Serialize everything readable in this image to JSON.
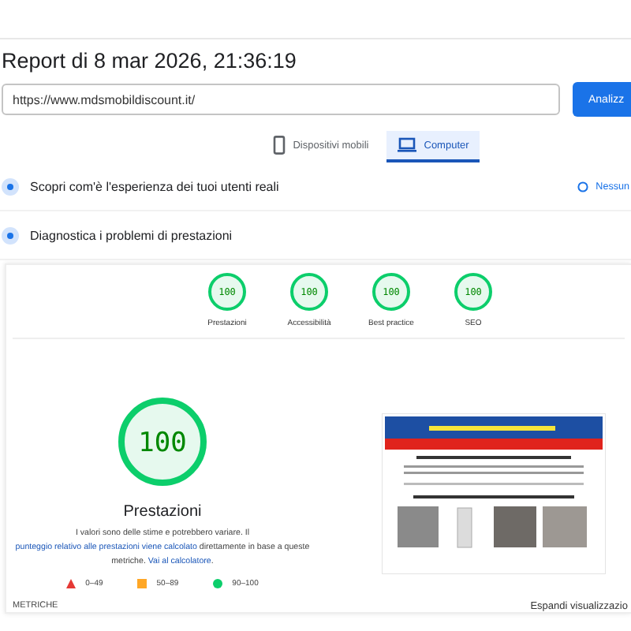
{
  "title": "Report di 8 mar 2026, 21:36:19",
  "url_field": {
    "value": "https://www.mdsmobildiscount.it/"
  },
  "analyze_button": "Analizz",
  "tabs": [
    {
      "label": "Dispositivi mobili",
      "kind": "phone",
      "selected": false
    },
    {
      "label": "Computer",
      "kind": "laptop",
      "selected": true
    }
  ],
  "sections": [
    {
      "label": "Scopri com'è l'esperienza dei tuoi utenti reali",
      "side_text": "Nessun"
    },
    {
      "label": "Diagnostica i problemi di prestazioni"
    }
  ],
  "scores": [
    {
      "value": "100",
      "label": "Prestazioni"
    },
    {
      "value": "100",
      "label": "Accessibilità"
    },
    {
      "value": "100",
      "label": "Best practice"
    },
    {
      "value": "100",
      "label": "SEO"
    }
  ],
  "main_score": {
    "value": "100",
    "label": "Prestazioni",
    "level": 1
  },
  "note": [
    {
      "kind": "text",
      "text": "I valori sono delle stime e potrebbero variare. Il "
    },
    {
      "kind": "link",
      "text": "punteggio relativo alle prestazioni viene calcolato"
    },
    {
      "kind": "text",
      "text": " direttamente in base a queste metriche. "
    },
    {
      "kind": "link",
      "text": "Vai al calcolatore"
    },
    {
      "kind": "text",
      "text": "."
    }
  ],
  "legend": [
    {
      "kind": "triangle",
      "color": "#e53935",
      "text": "0–49"
    },
    {
      "kind": "square",
      "color": "#ffa726",
      "text": "50–89"
    },
    {
      "kind": "circle",
      "color": "#0cce6b",
      "text": "90–100"
    }
  ],
  "metrics_heading": "METRICHE",
  "expand_link": "Espandi visualizzazio"
}
